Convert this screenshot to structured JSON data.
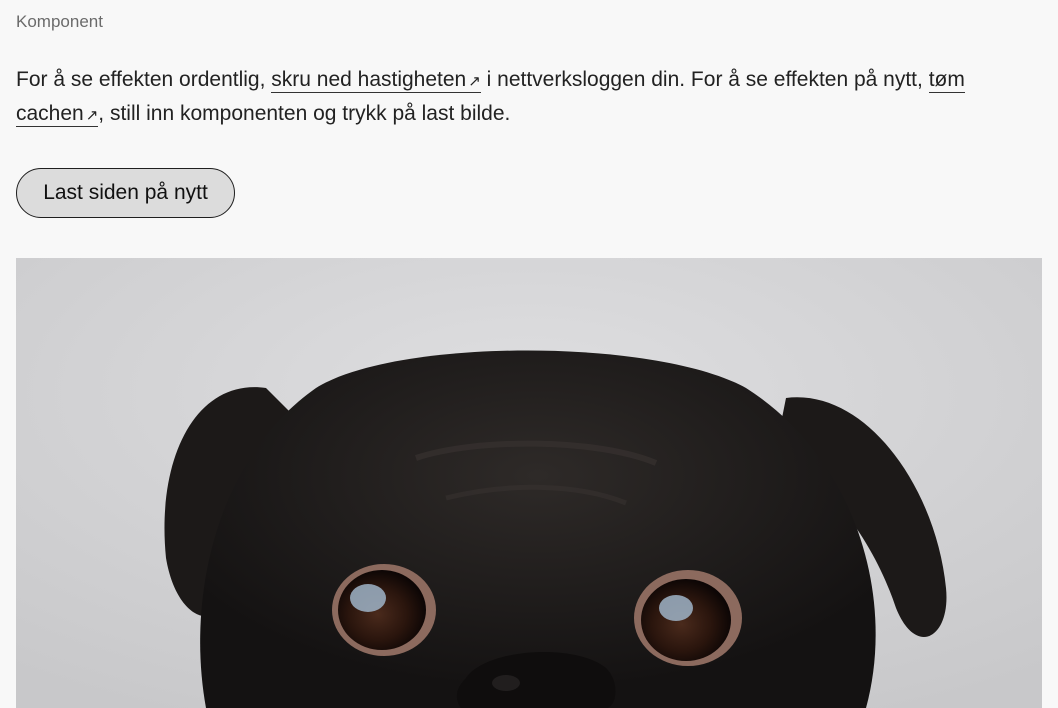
{
  "component_label": "Komponent",
  "intro": {
    "text_1": "For å se effekten ordentlig, ",
    "link_1": "skru ned hastigheten",
    "text_2": " i nettverksloggen din. For å se effekten på nytt, ",
    "link_2": "tøm cachen",
    "text_3": ", still inn komponenten og trykk på last bilde.",
    "external_icon": "↗"
  },
  "reload_button": {
    "label": "Last siden på nytt"
  },
  "image": {
    "subject": "black-pug-photo"
  }
}
